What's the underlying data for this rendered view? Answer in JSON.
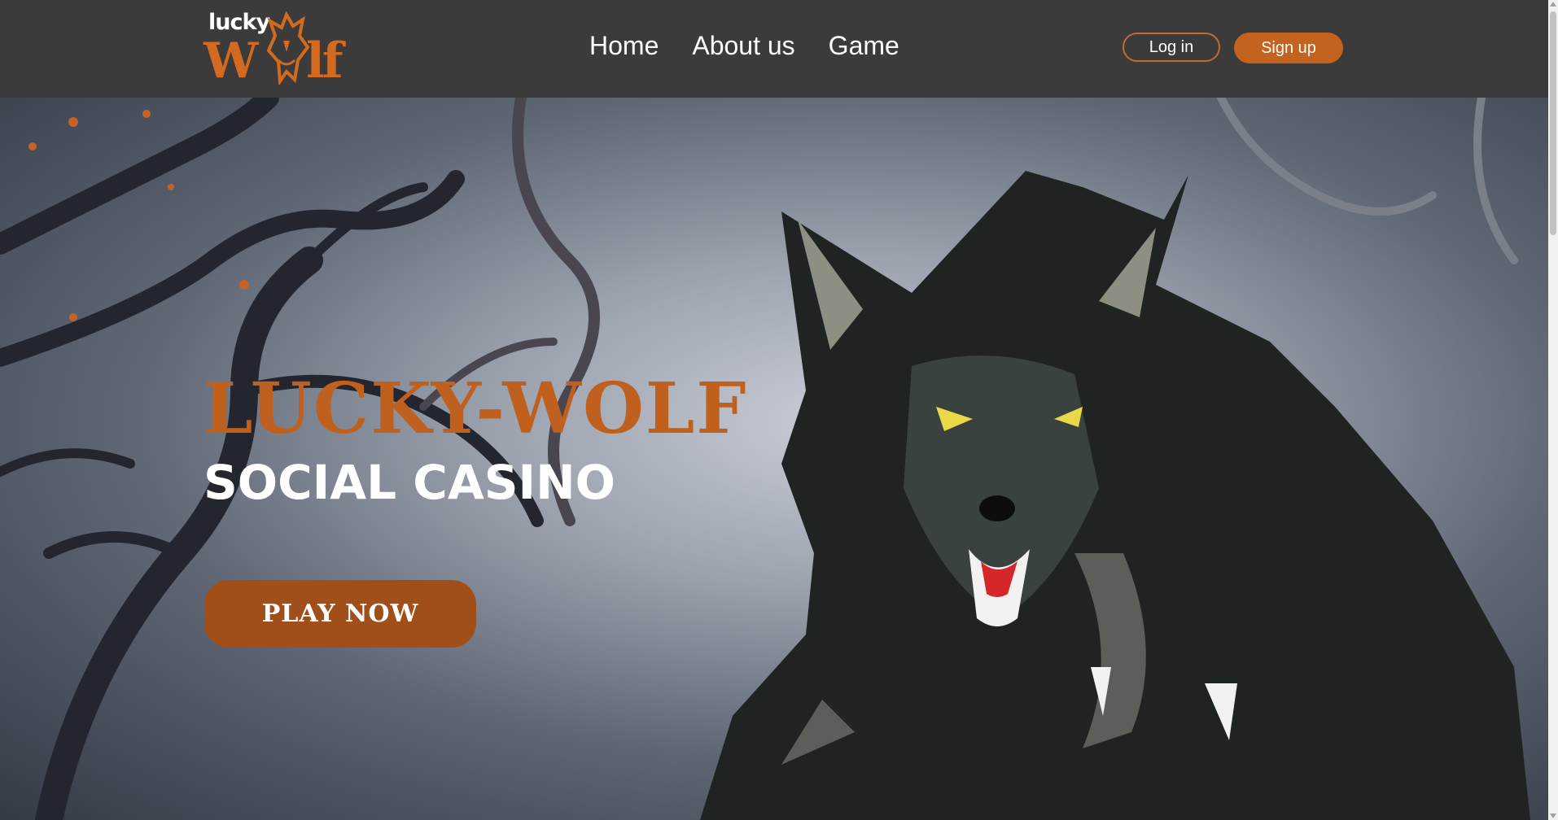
{
  "logo": {
    "top_text": "lucky",
    "left_text": "W",
    "right_text": "lf"
  },
  "nav": {
    "items": [
      "Home",
      "About us",
      "Game"
    ]
  },
  "auth": {
    "login_label": "Log in",
    "signup_label": "Sign up"
  },
  "hero": {
    "title": "LUCKY-WOLF",
    "subtitle": "SOCIAL CASINO",
    "cta_label": "PLAY NOW"
  },
  "colors": {
    "header_bg": "#3b3b3b",
    "accent": "#c4621f",
    "cta_bg": "#a04e1a",
    "text": "#ffffff"
  },
  "icons": {
    "logo_mark": "wolf-head-icon",
    "hero_illustration": "wolf-illustration"
  }
}
